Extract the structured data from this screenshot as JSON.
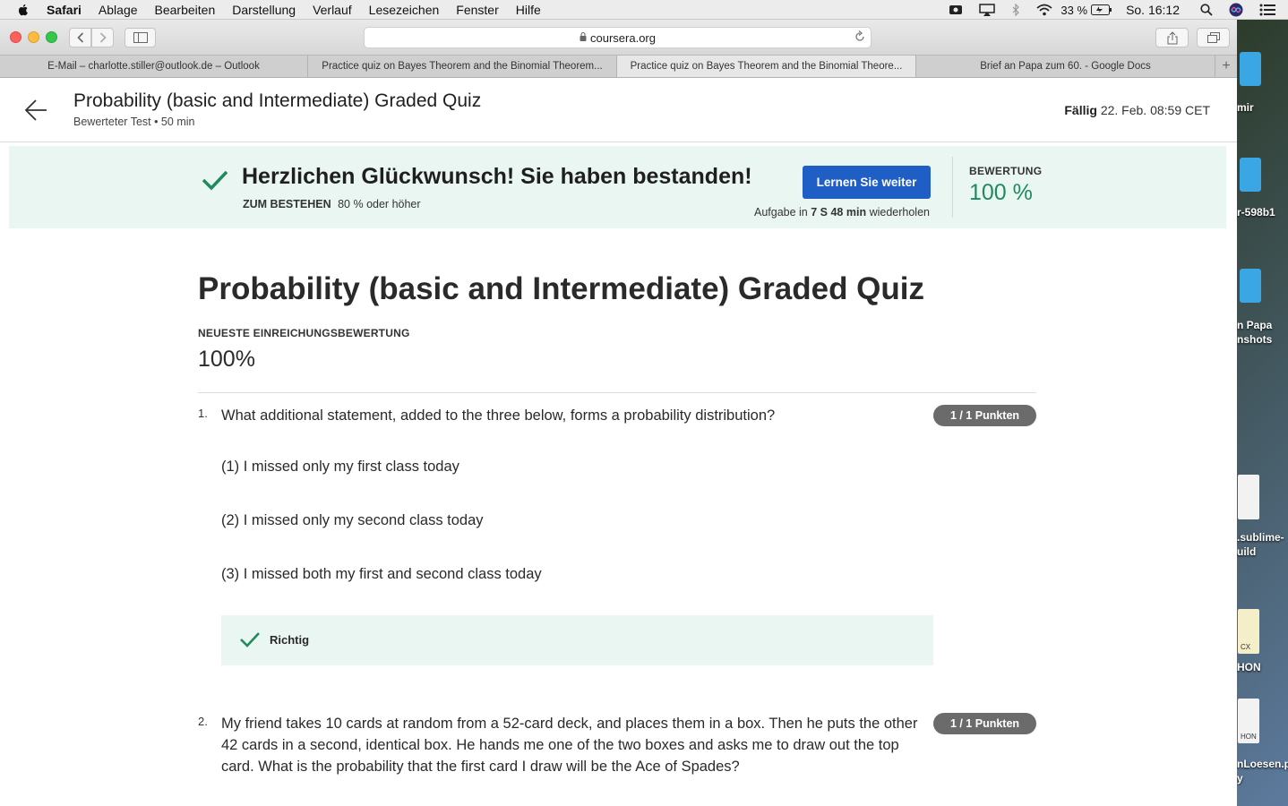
{
  "menubar": {
    "items": [
      "Safari",
      "Ablage",
      "Bearbeiten",
      "Darstellung",
      "Verlauf",
      "Lesezeichen",
      "Fenster",
      "Hilfe"
    ],
    "battery": "33 %",
    "clock": "So. 16:12"
  },
  "browser": {
    "url": "coursera.org",
    "tabs": [
      {
        "label": "E-Mail – charlotte.stiller@outlook.de – Outlook"
      },
      {
        "label": "Practice quiz on Bayes Theorem and the Binomial Theorem..."
      },
      {
        "label": "Practice quiz on Bayes Theorem and the Binomial Theore..."
      },
      {
        "label": "Brief an Papa zum 60. - Google Docs"
      }
    ]
  },
  "desktop": {
    "labels": [
      "mir",
      "r-598b1",
      "n Papa",
      "nshots",
      ".sublime-",
      "uild",
      "HON",
      "nLoesen.p",
      "y"
    ],
    "icon_text": [
      "CX",
      "HON"
    ]
  },
  "header": {
    "title": "Probability (basic and Intermediate) Graded Quiz",
    "subtitle": "Bewerteter Test • 50 min",
    "due_label": "Fällig",
    "due_value": "22. Feb. 08:59 CET"
  },
  "banner": {
    "title": "Herzlichen Glückwunsch! Sie haben bestanden!",
    "pass_label": "ZUM BESTEHEN",
    "pass_value": "80 % oder höher",
    "continue_button": "Lernen Sie weiter",
    "retry_prefix": "Aufgabe in",
    "retry_time": "7 S 48 min",
    "retry_suffix": "wiederholen",
    "grade_label": "BEWERTUNG",
    "grade_value": "100 %"
  },
  "main": {
    "title": "Probability (basic and Intermediate) Graded Quiz",
    "latest_label": "NEUESTE EINREICHUNGSBEWERTUNG",
    "latest_value": "100%"
  },
  "questions": [
    {
      "number": "1.",
      "text": "What additional statement, added to the three below, forms a probability distribution?",
      "points": "1 / 1 Punkten",
      "options": [
        "(1) I missed only my first class today",
        "(2) I missed only my second class today",
        "(3) I missed both my first and second class today"
      ],
      "feedback": "Richtig"
    },
    {
      "number": "2.",
      "text": "My friend takes 10 cards at random from a 52-card deck, and places them in a box. Then he puts the other 42 cards in a second, identical box. He hands me one of the two boxes and asks me to draw out the top card. What is the probability that the first card I draw will be the Ace of Spades?",
      "points": "1 / 1 Punkten"
    }
  ],
  "colors": {
    "accent_green": "#1f8a5d",
    "banner_bg": "#eaf6f1",
    "button_blue": "#1f5fc5",
    "pill_gray": "#6b6b6b"
  }
}
